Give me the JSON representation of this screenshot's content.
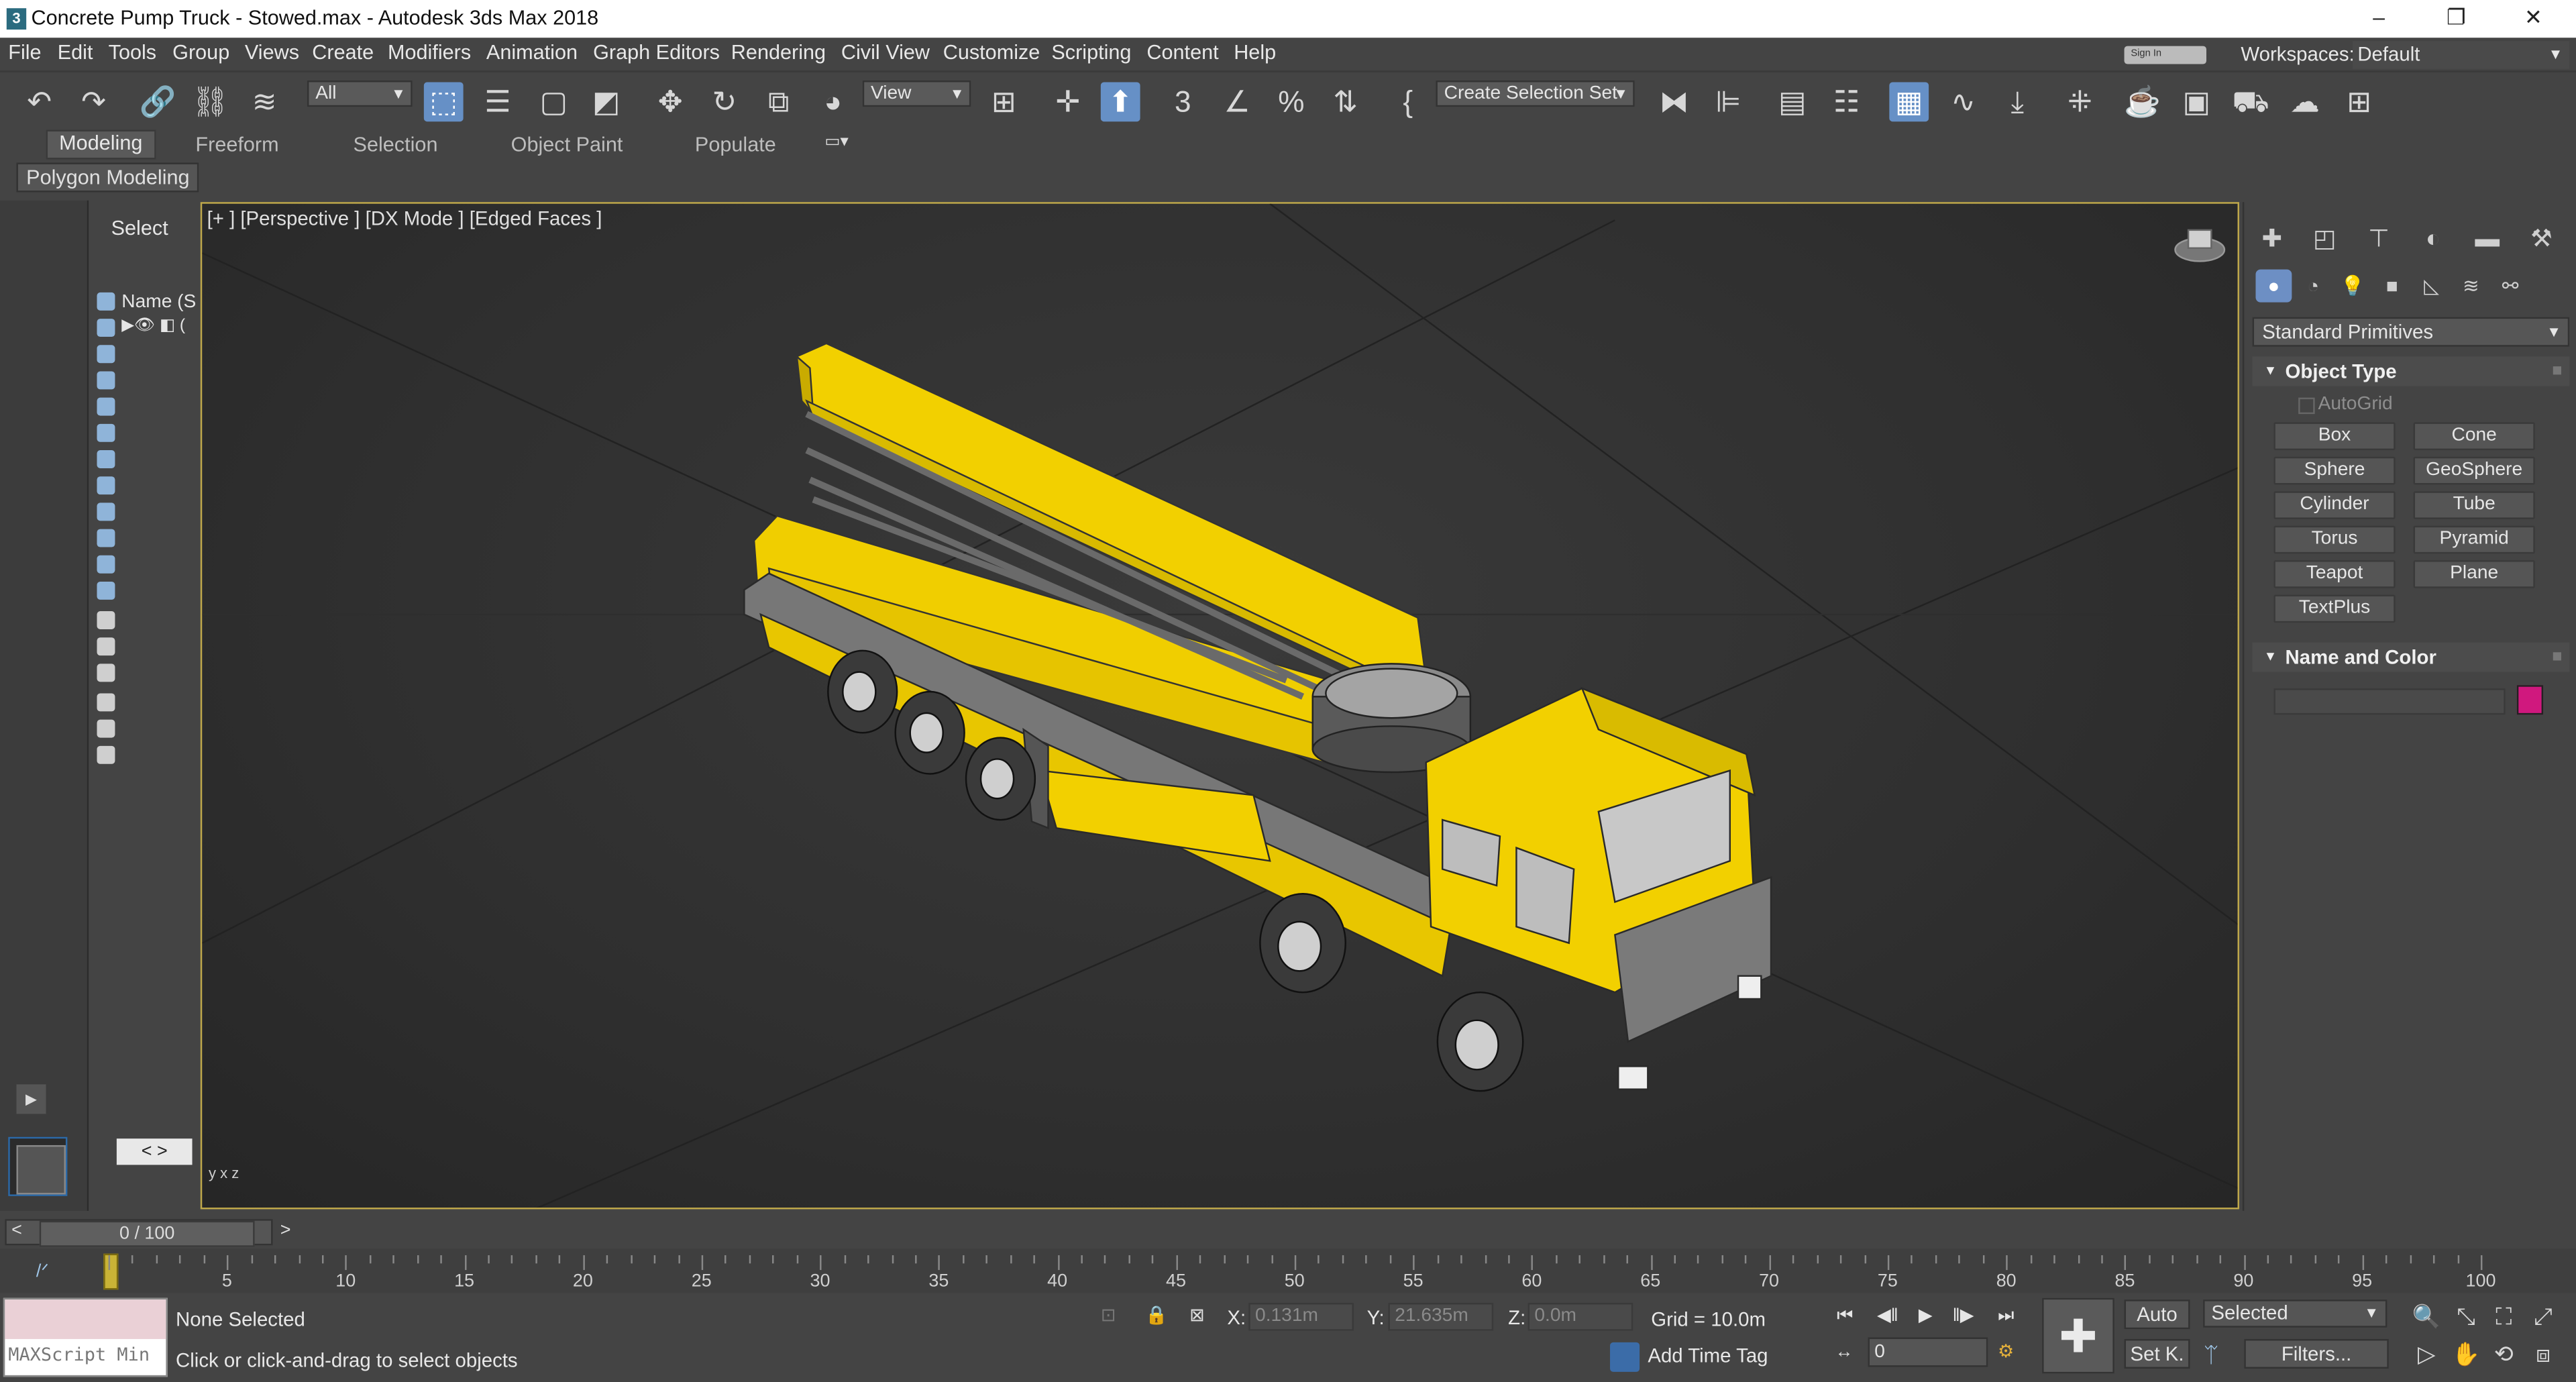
{
  "window": {
    "title": "Concrete Pump Truck - Stowed.max - Autodesk 3ds Max 2018",
    "app_icon": "3",
    "controls": [
      "–",
      "❐",
      "✕"
    ]
  },
  "menu": [
    "File",
    "Edit",
    "Tools",
    "Group",
    "Views",
    "Create",
    "Modifiers",
    "Animation",
    "Graph Editors",
    "Rendering",
    "Civil View",
    "Customize",
    "Scripting",
    "Content",
    "Help"
  ],
  "signin": "Sign In",
  "workspaces": {
    "label": "Workspaces:",
    "value": "Default"
  },
  "toolbar": {
    "filter": "All",
    "ref_coord": "View",
    "selection_set": "Create Selection Set"
  },
  "ribbon": {
    "tabs": [
      "Modeling",
      "Freeform",
      "Selection",
      "Object Paint",
      "Populate"
    ],
    "active_tab": "Modeling",
    "panel_label": "Polygon Modeling"
  },
  "scene_explorer": {
    "select_label": "Select",
    "column_header": "Name (S",
    "row_icons": "▶👁 ◧ (",
    "nav": "< >"
  },
  "viewport": {
    "label": "[+ ] [Perspective ]  [DX Mode ] [Edged Faces ]",
    "axes": "y x z",
    "accent": "#bfa84a",
    "model_color": "#f2d000"
  },
  "command_panel": {
    "category": "Standard Primitives",
    "rollout_object_type": "Object Type",
    "autogrid": "AutoGrid",
    "primitives": [
      "Box",
      "Cone",
      "Sphere",
      "GeoSphere",
      "Cylinder",
      "Tube",
      "Torus",
      "Pyramid",
      "Teapot",
      "Plane",
      "TextPlus"
    ],
    "rollout_name_color": "Name and Color",
    "object_color": "#d0187e"
  },
  "timeline": {
    "frame_display": "0 / 100",
    "prev": "<",
    "next": ">",
    "ticks": [
      "5",
      "10",
      "15",
      "20",
      "25",
      "30",
      "35",
      "40",
      "45",
      "50",
      "55",
      "60",
      "65",
      "70",
      "75",
      "80",
      "85",
      "90",
      "95",
      "100"
    ]
  },
  "status": {
    "maxscript_label": "MAXScript Min",
    "selection_status": "None Selected",
    "prompt": "Click or click-and-drag to select objects",
    "x_label": "X:",
    "x_value": "0.131m",
    "y_label": "Y:",
    "y_value": "21.635m",
    "z_label": "Z:",
    "z_value": "0.0m",
    "grid": "Grid = 10.0m",
    "add_time_tag": "Add Time Tag",
    "current_frame": "0",
    "auto_key": "Auto",
    "set_key": "Set K.",
    "key_filter_select": "Selected",
    "filters": "Filters..."
  }
}
